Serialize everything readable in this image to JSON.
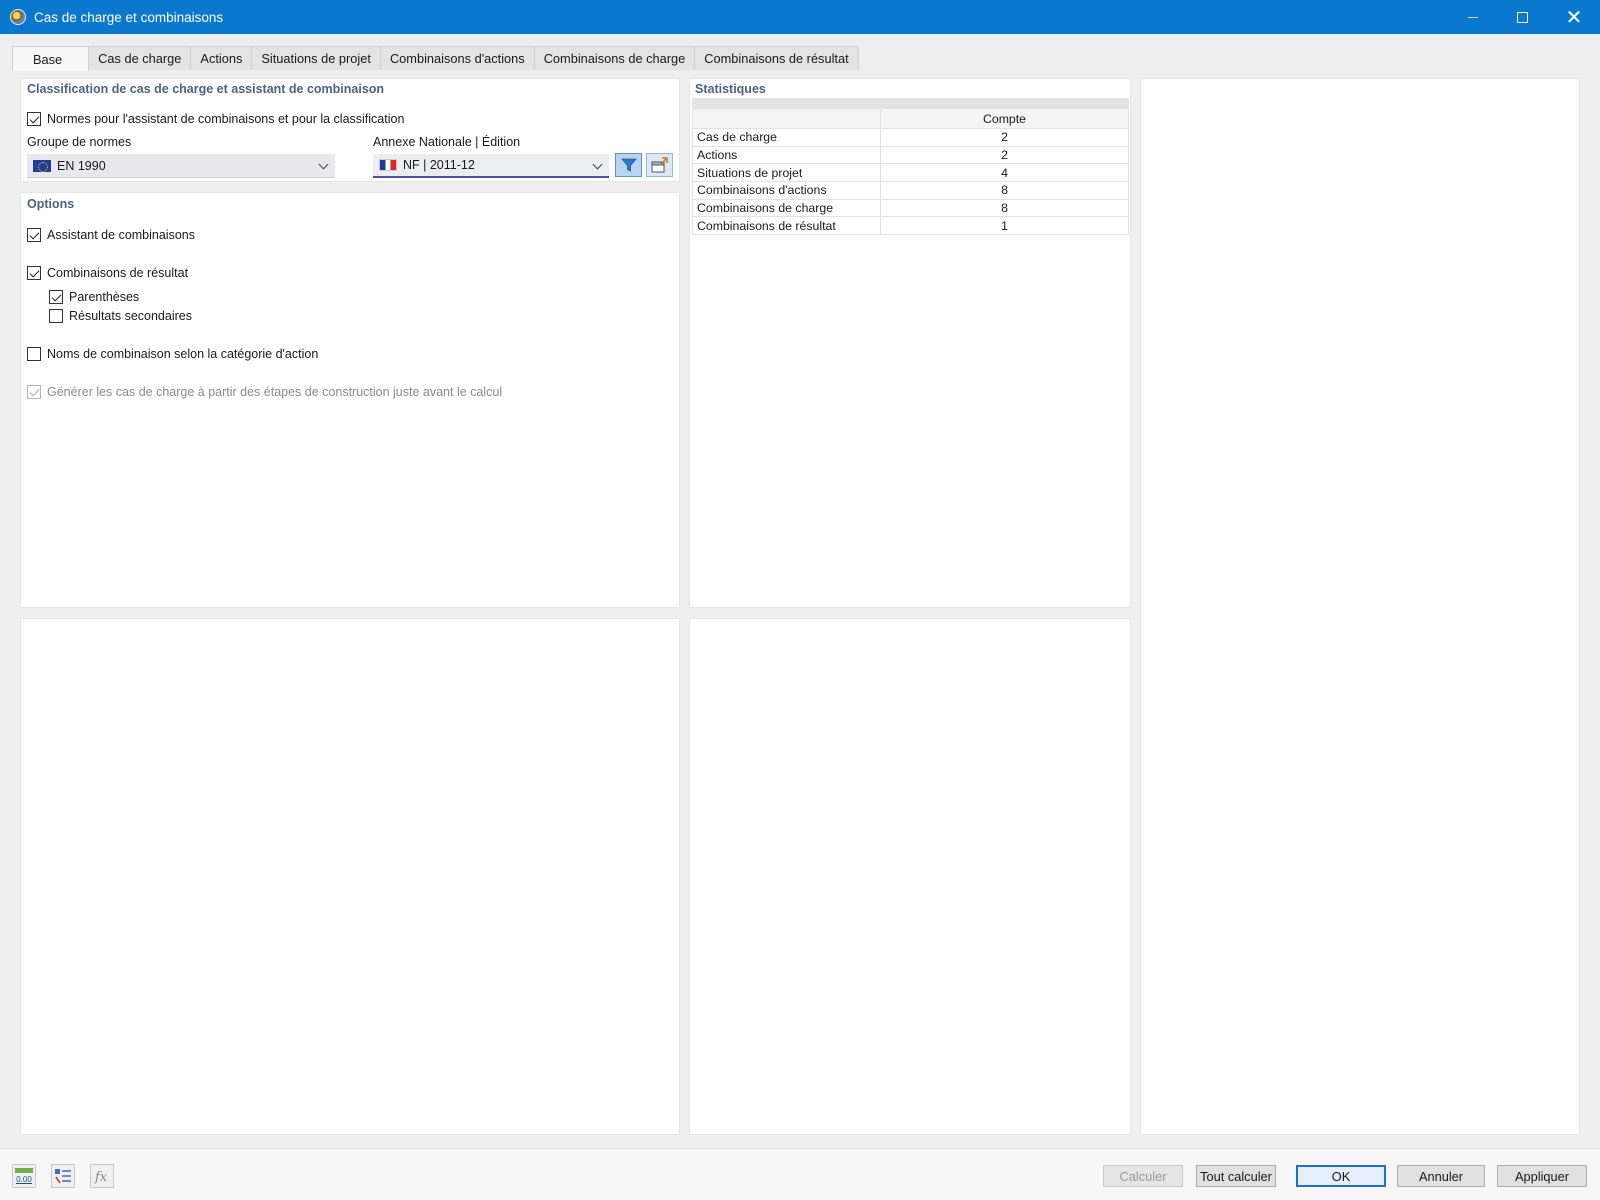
{
  "window": {
    "title": "Cas de charge et combinaisons"
  },
  "tabs": [
    {
      "label": "Base",
      "active": true
    },
    {
      "label": "Cas de charge"
    },
    {
      "label": "Actions"
    },
    {
      "label": "Situations de projet"
    },
    {
      "label": "Combinaisons d'actions"
    },
    {
      "label": "Combinaisons de charge"
    },
    {
      "label": "Combinaisons de résultat"
    }
  ],
  "classification": {
    "title": "Classification de cas de charge et assistant de combinaison",
    "norms_checkbox": {
      "label": "Normes pour l'assistant de combinaisons et pour la classification",
      "checked": true
    },
    "norm_group_label": "Groupe de normes",
    "norm_group_value": "EN 1990",
    "annex_label": "Annexe Nationale | Édition",
    "annex_value": "NF | 2011-12"
  },
  "options": {
    "title": "Options",
    "combination_wizard": {
      "label": "Assistant de combinaisons",
      "checked": true
    },
    "result_combinations": {
      "label": "Combinaisons de résultat",
      "checked": true
    },
    "parentheses": {
      "label": "Parenthèses",
      "checked": true
    },
    "secondary_results": {
      "label": "Résultats secondaires",
      "checked": false
    },
    "names_by_category": {
      "label": "Noms de combinaison selon la catégorie d'action",
      "checked": false
    },
    "generate_load_cases": {
      "label": "Générer les cas de charge à partir des étapes de construction juste avant le calcul",
      "checked": true,
      "disabled": true
    }
  },
  "statistics": {
    "title": "Statistiques",
    "column_header": "Compte",
    "rows": [
      {
        "name": "Cas de charge",
        "count": "2"
      },
      {
        "name": "Actions",
        "count": "2"
      },
      {
        "name": "Situations de projet",
        "count": "4"
      },
      {
        "name": "Combinaisons d'actions",
        "count": "8"
      },
      {
        "name": "Combinaisons de charge",
        "count": "8"
      },
      {
        "name": "Combinaisons de résultat",
        "count": "1"
      }
    ]
  },
  "footer": {
    "calculate": "Calculer",
    "calculate_all": "Tout calculer",
    "ok": "OK",
    "cancel": "Annuler",
    "apply": "Appliquer",
    "units_icon_text": "0.00"
  },
  "colors": {
    "titlebar": "#0b78d0",
    "section_title": "#4a6485",
    "primary_border": "#1f6fd1"
  }
}
